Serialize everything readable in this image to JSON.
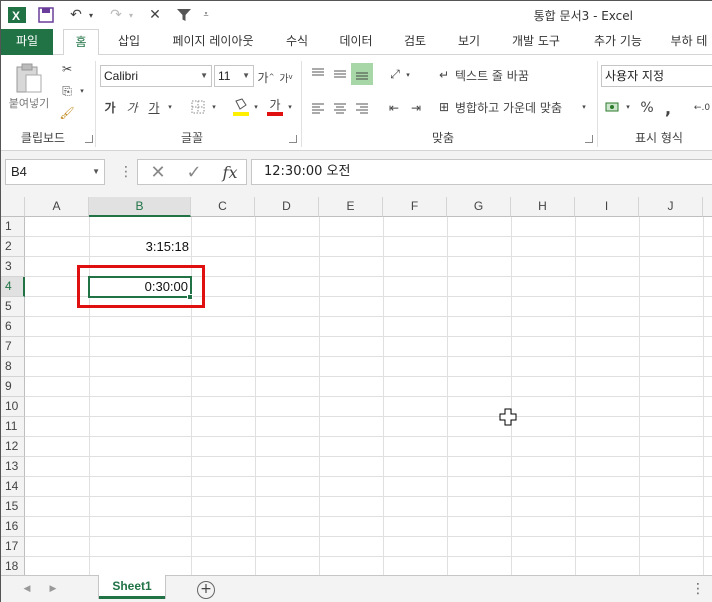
{
  "window": {
    "title": "통합 문서3 - Excel"
  },
  "tabs": [
    "파일",
    "홈",
    "삽입",
    "페이지 레이아웃",
    "수식",
    "데이터",
    "검토",
    "보기",
    "개발 도구",
    "추가 기능",
    "부하 테"
  ],
  "ribbon": {
    "clipboard": {
      "paste_label": "붙여넣기",
      "group_label": "클립보드"
    },
    "font": {
      "font_name": "Calibri",
      "font_size": "11",
      "group_label": "글꼴",
      "bold": "가",
      "italic": "가",
      "underline": "가",
      "grow": "가",
      "shrink": "가",
      "font_color_glyph": "가"
    },
    "alignment": {
      "wrap_text": "텍스트 줄 바꿈",
      "merge_center": "병합하고 가운데 맞춤",
      "group_label": "맞춤"
    },
    "number": {
      "format": "사용자 지정",
      "percent": "%",
      "comma": ",",
      "group_label": "표시 형식"
    }
  },
  "formula_bar": {
    "name_box": "B4",
    "fx": "fx",
    "value": "12:30:00 오전"
  },
  "grid": {
    "columns": [
      "A",
      "B",
      "C",
      "D",
      "E",
      "F",
      "G",
      "H",
      "I",
      "J"
    ],
    "rows": [
      "1",
      "2",
      "3",
      "4",
      "5",
      "6",
      "7",
      "8",
      "9",
      "10",
      "11",
      "12",
      "13",
      "14",
      "15",
      "16",
      "17",
      "18"
    ],
    "cells": {
      "B2": "3:15:18",
      "B4": "0:30:00"
    },
    "active_cell": "B4",
    "highlight_color": "#e01010"
  },
  "sheets": {
    "tabs": [
      "Sheet1"
    ],
    "add_label": "+"
  },
  "colors": {
    "accent": "#217346"
  }
}
